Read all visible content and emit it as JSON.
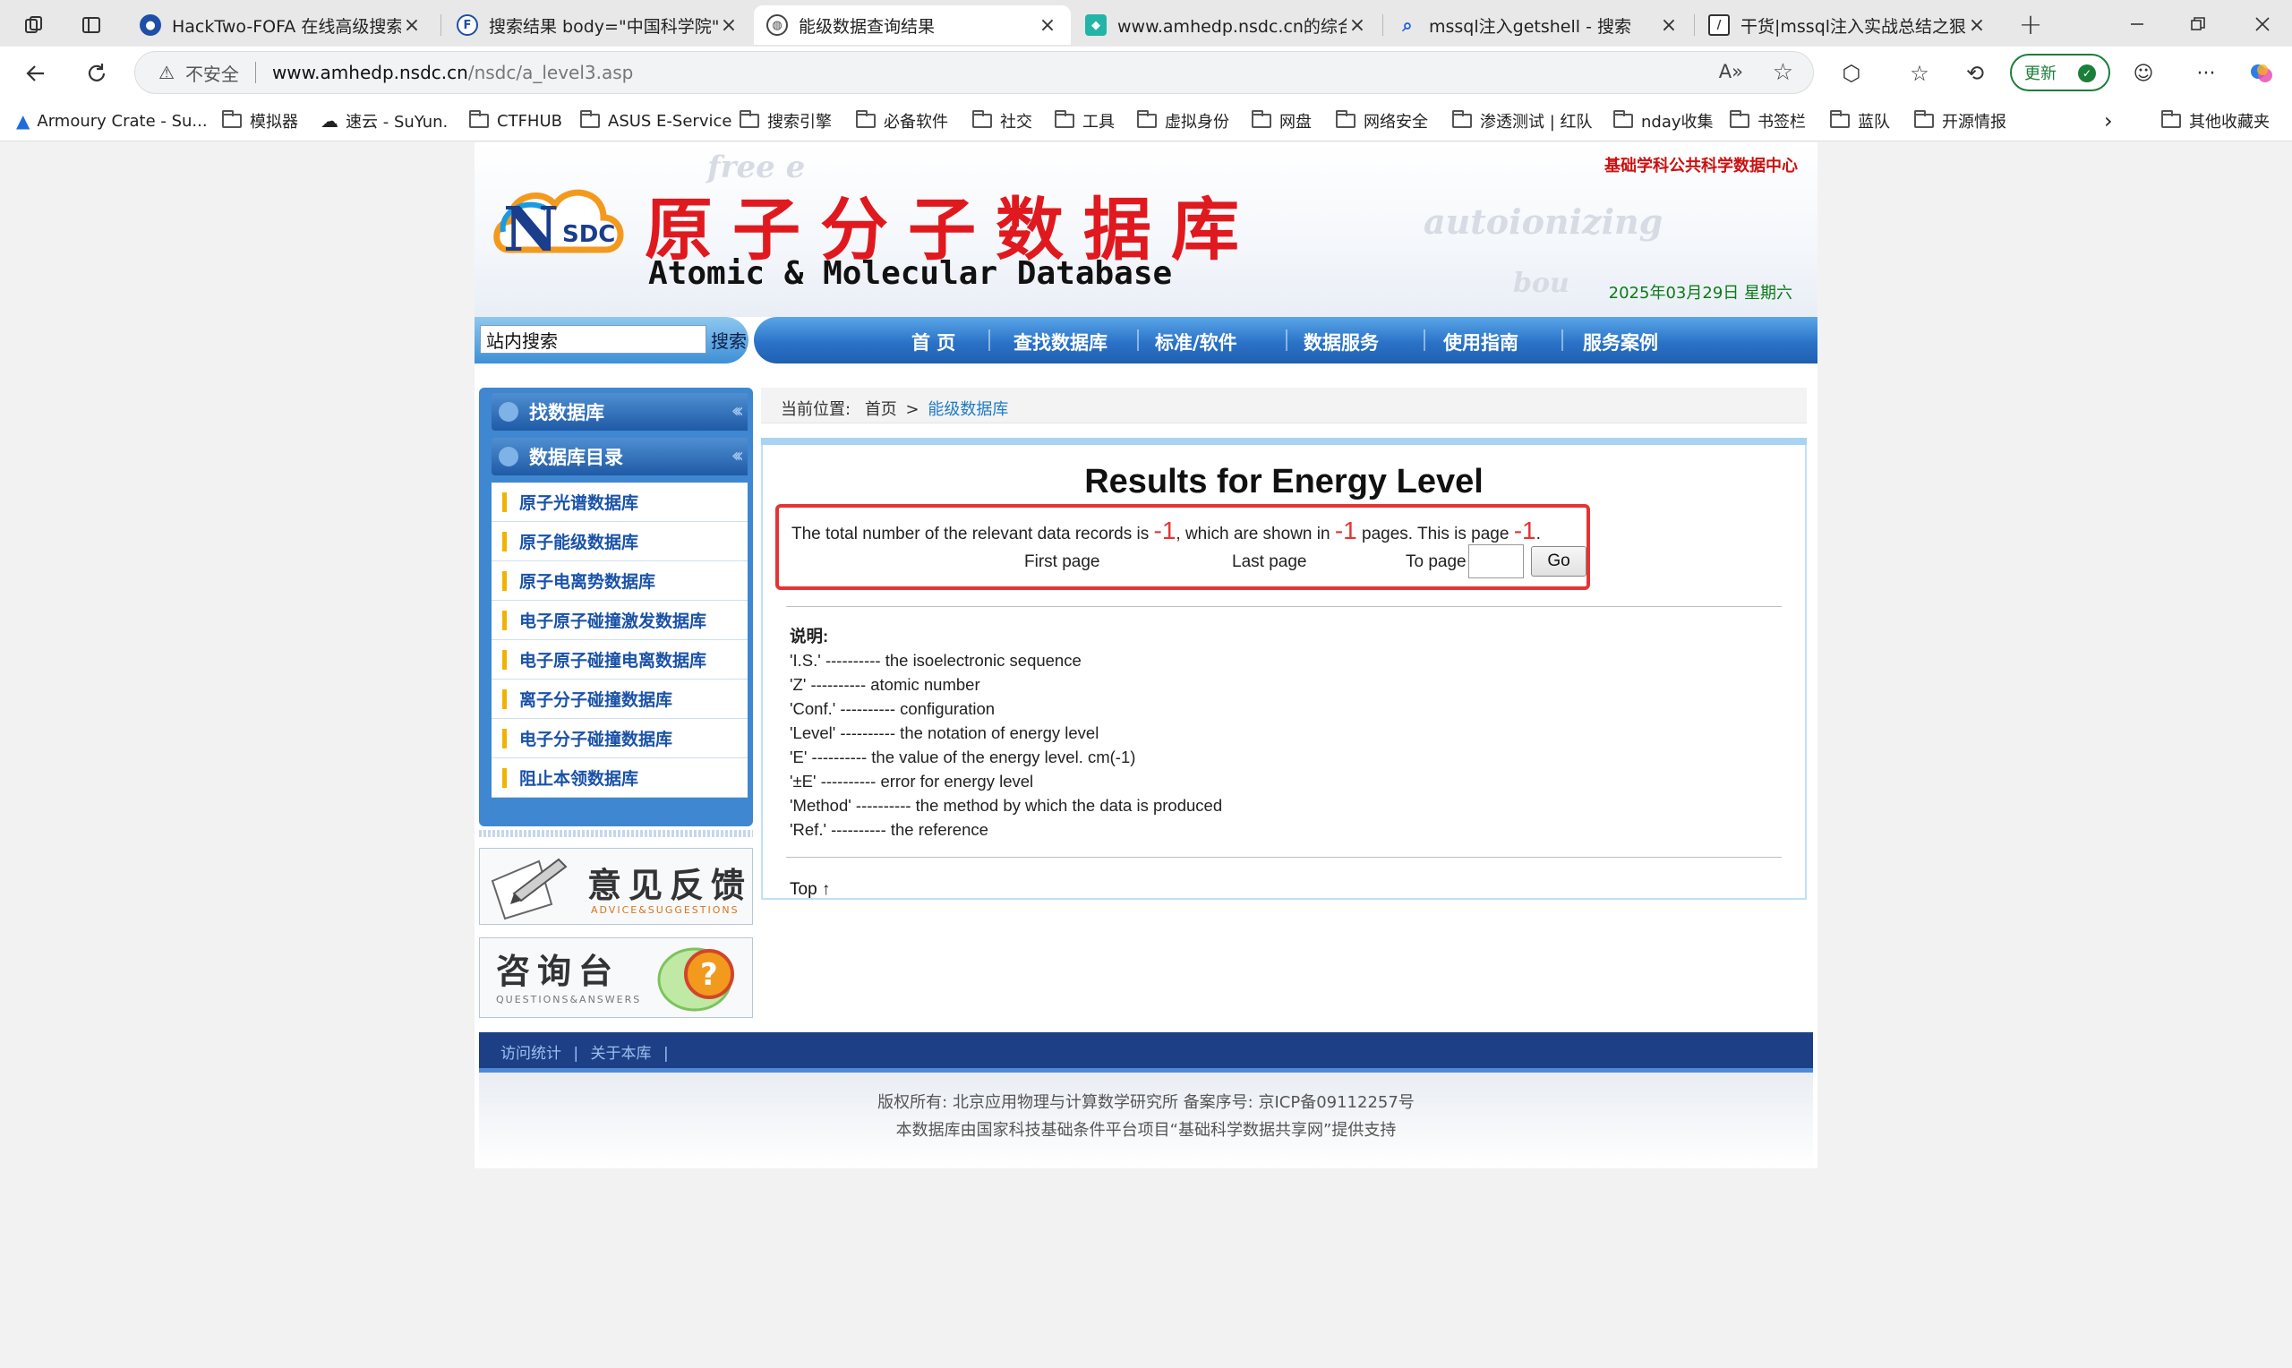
{
  "browser": {
    "tabs": [
      {
        "title": "HackTwo-FOFA 在线高级搜索小",
        "active": false
      },
      {
        "title": "搜索结果 body=\"中国科学院\" &",
        "active": false
      },
      {
        "title": "能级数据查询结果",
        "active": true
      },
      {
        "title": "www.amhedp.nsdc.cn的综合查询",
        "active": false
      },
      {
        "title": "mssql注入getshell - 搜索",
        "active": false
      },
      {
        "title": "干货|mssql注入实战总结之狠快准",
        "active": false
      }
    ],
    "address": {
      "security_label": "不安全",
      "host": "www.amhedp.nsdc.cn",
      "path": "/nsdc/a_level3.asp"
    },
    "update_label": "更新",
    "bookmarks": [
      "Armoury Crate - Su...",
      "模拟器",
      "速云 - SuYun.",
      "CTFHUB",
      "ASUS E-Service",
      "搜索引擎",
      "必备软件",
      "社交",
      "工具",
      "虚拟身份",
      "网盘",
      "网络安全",
      "渗透测试 | 红队",
      "nday收集",
      "书签栏",
      "蓝队",
      "开源情报"
    ],
    "other_bookmarks": "其他收藏夹"
  },
  "site": {
    "banner": {
      "cn_title": "原子分子数据库",
      "en_title": "Atomic & Molecular Database",
      "center_name": "基础学科公共科学数据中心",
      "date": "2025年03月29日 星期六",
      "logo_letter": "N",
      "logo_text": "SDC",
      "bg_words": [
        "free e",
        "autoionizing",
        "bou"
      ]
    },
    "search": {
      "value": "站内搜索",
      "button": "搜索"
    },
    "nav": [
      "首 页",
      "查找数据库",
      "标准/软件",
      "数据服务",
      "使用指南",
      "服务案例"
    ],
    "sidebar": {
      "headers": [
        "找数据库",
        "数据库目录"
      ],
      "items": [
        "原子光谱数据库",
        "原子能级数据库",
        "原子电离势数据库",
        "电子原子碰撞激发数据库",
        "电子原子碰撞电离数据库",
        "离子分子碰撞数据库",
        "电子分子碰撞数据库",
        "阻止本领数据库"
      ]
    },
    "promos": {
      "feedback": {
        "title": "意见反馈",
        "subtitle": "ADVICE&SUGGESTIONS"
      },
      "qa": {
        "title": "咨询台",
        "subtitle": "QUESTIONS&ANSWERS"
      }
    },
    "breadcrumb": {
      "prefix": "当前位置:",
      "home": "首页",
      "arrow": ">",
      "current": "能级数据库"
    },
    "results": {
      "title": "Results for Energy Level",
      "text_1": "The total number of the relevant data records is ",
      "total_records": "-1",
      "text_2": ", which are shown in ",
      "total_pages": "-1",
      "text_3": " pages. This is page ",
      "current_page": "-1",
      "text_4": ".",
      "first_page": "First page",
      "last_page": "Last page",
      "to_page": "To page",
      "page_value": "",
      "go": "Go"
    },
    "legend": {
      "heading": "说明:",
      "lines": [
        "'I.S.' ---------- the isoelectronic sequence",
        "'Z' ---------- atomic number",
        "'Conf.' ---------- configuration",
        "'Level' ---------- the notation of energy level",
        "'E' ---------- the value of the energy level. cm(-1)",
        "'±E' ---------- error for energy level",
        "'Method' ---------- the method by which the data is produced",
        "'Ref.' ---------- the reference"
      ]
    },
    "top_link": "Top ↑",
    "footer": {
      "links": [
        "访问统计",
        "关于本库"
      ],
      "separator": "|",
      "copyright": "版权所有: 北京应用物理与计算数学研究所 备案序号: 京ICP备09112257号",
      "support": "本数据库由国家科技基础条件平台项目“基础科学数据共享网”提供支持"
    }
  }
}
